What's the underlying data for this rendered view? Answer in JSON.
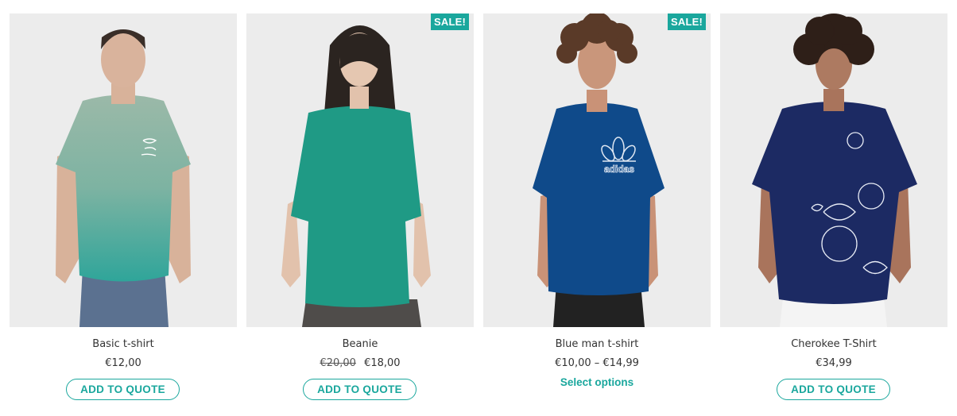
{
  "products": [
    {
      "title": "Basic t-shirt",
      "price": "€12,00",
      "button_label": "ADD TO QUOTE"
    },
    {
      "title": "Beanie",
      "badge": "SALE!",
      "price_old": "€20,00",
      "price": "€18,00",
      "button_label": "ADD TO QUOTE"
    },
    {
      "title": "Blue man t-shirt",
      "badge": "SALE!",
      "price": "€10,00 – €14,99",
      "button_label": "Select options",
      "print_text": "adidas"
    },
    {
      "title": "Cherokee T-Shirt",
      "price": "€34,99",
      "button_label": "ADD TO QUOTE"
    }
  ],
  "colors": {
    "accent": "#1aa79d",
    "photo_bg": "#ececec",
    "shirt_sage": "#8fb5a2",
    "shirt_teal": "#1e9a84",
    "shirt_blue": "#0f4a8a",
    "shirt_navy": "#1c2a63"
  }
}
